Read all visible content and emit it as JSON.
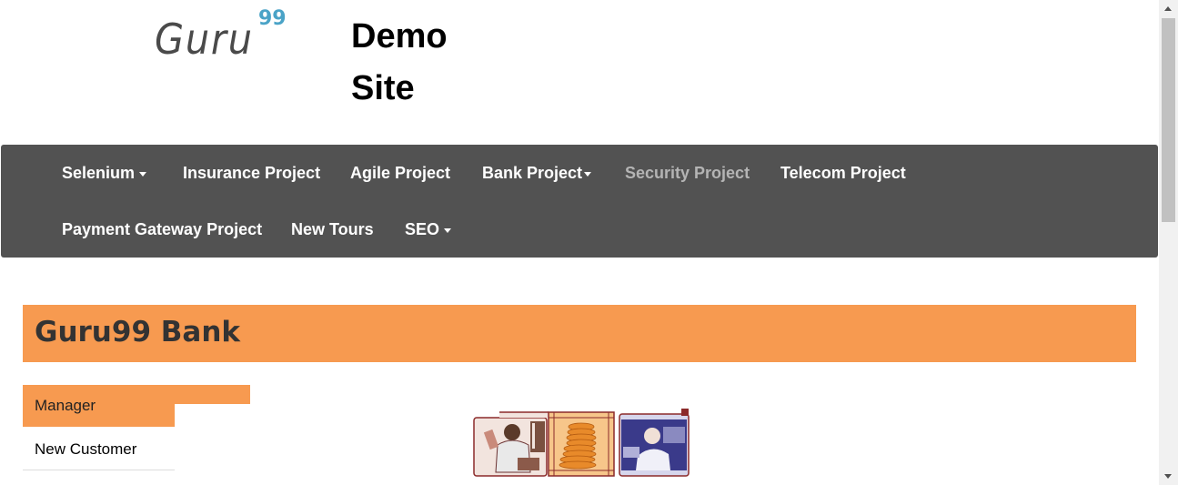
{
  "header": {
    "logo": {
      "text": "Guru",
      "superscript": "99"
    },
    "site_title": "Demo Site"
  },
  "navbar": {
    "items": [
      {
        "label": "Selenium",
        "dropdown": true
      },
      {
        "label": "Insurance Project",
        "dropdown": false
      },
      {
        "label": "Agile Project",
        "dropdown": false
      },
      {
        "label": "Bank Project",
        "dropdown": true
      },
      {
        "label": "Security Project",
        "dropdown": false,
        "muted": true
      },
      {
        "label": "Telecom Project",
        "dropdown": false
      },
      {
        "label": "Payment Gateway Project",
        "dropdown": false
      },
      {
        "label": "New Tours",
        "dropdown": false
      },
      {
        "label": "SEO",
        "dropdown": true
      }
    ]
  },
  "banner": {
    "title": "Guru99 Bank"
  },
  "sidebar": {
    "header": "Manager",
    "items": [
      {
        "label": "New Customer"
      }
    ]
  },
  "colors": {
    "accent": "#f79a50",
    "navbar_bg": "#525252",
    "logo_superscript": "#4aa3c7"
  }
}
